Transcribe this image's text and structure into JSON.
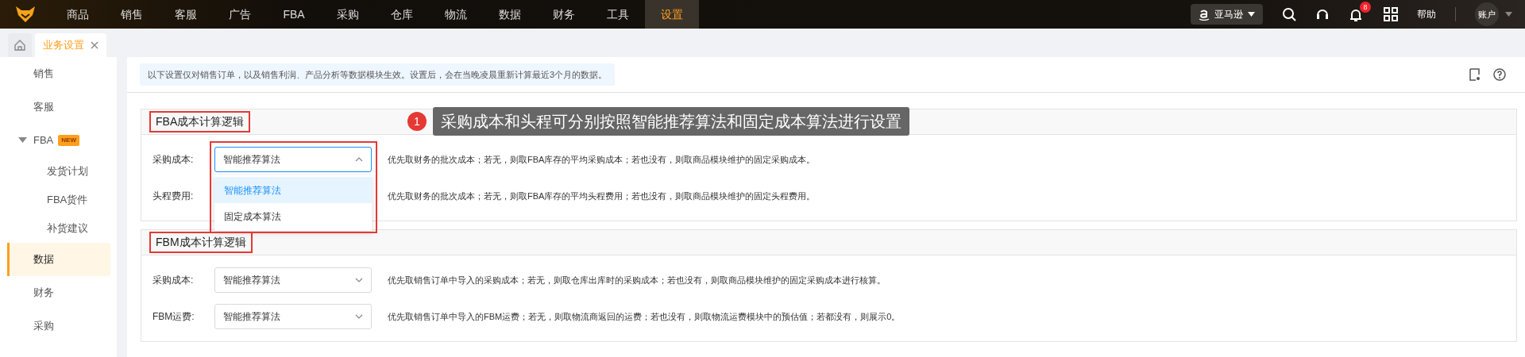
{
  "top_nav": {
    "items": [
      {
        "label": "商品",
        "selected": false
      },
      {
        "label": "销售",
        "selected": false
      },
      {
        "label": "客服",
        "selected": false
      },
      {
        "label": "广告",
        "selected": false
      },
      {
        "label": "FBA",
        "selected": false
      },
      {
        "label": "采购",
        "selected": false
      },
      {
        "label": "仓库",
        "selected": false
      },
      {
        "label": "物流",
        "selected": false
      },
      {
        "label": "数据",
        "selected": false
      },
      {
        "label": "财务",
        "selected": false
      },
      {
        "label": "工具",
        "selected": false
      },
      {
        "label": "设置",
        "selected": true
      }
    ],
    "marketplace": "亚马逊",
    "notification_count": "8",
    "help": "帮助",
    "account": "账户"
  },
  "tabs": [
    {
      "label": "业务设置",
      "selected": true
    }
  ],
  "sidebar": {
    "items": [
      {
        "label": "销售",
        "selected": false
      },
      {
        "label": "客服",
        "selected": false
      },
      {
        "label": "FBA",
        "badge": "NEW",
        "expanded": true,
        "selected": false,
        "children": [
          {
            "label": "发货计划",
            "selected": false
          },
          {
            "label": "FBA货件",
            "selected": false
          },
          {
            "label": "补货建议",
            "selected": false
          }
        ]
      },
      {
        "label": "数据",
        "selected": true
      },
      {
        "label": "财务",
        "selected": false
      },
      {
        "label": "采购",
        "selected": false
      }
    ]
  },
  "notice": "以下设置仅对销售订单，以及销售利润、产品分析等数据模块生效。设置后，会在当晚凌晨重新计算最近3个月的数据。",
  "sections": [
    {
      "title": "FBA成本计算逻辑",
      "highlighted": true,
      "rows": [
        {
          "label": "采购成本:",
          "value": "智能推荐算法",
          "expanded": true,
          "options": [
            {
              "label": "智能推荐算法",
              "selected": true
            },
            {
              "label": "固定成本算法",
              "selected": false
            }
          ],
          "description": "优先取财务的批次成本；若无，则取FBA库存的平均采购成本；若也没有，则取商品模块维护的固定采购成本。"
        },
        {
          "label": "头程费用:",
          "description": "优先取财务的批次成本；若无，则取FBA库存的平均头程费用；若也没有，则取商品模块维护的固定头程费用。"
        }
      ]
    },
    {
      "title": "FBM成本计算逻辑",
      "highlighted": true,
      "rows": [
        {
          "label": "采购成本:",
          "value": "智能推荐算法",
          "expanded": false,
          "description": "优先取销售订单中导入的采购成本；若无，则取仓库出库时的采购成本；若也没有，则取商品模块维护的固定采购成本进行核算。"
        },
        {
          "label": "FBM运费:",
          "value": "智能推荐算法",
          "expanded": false,
          "description": "优先取销售订单中导入的FBM运费；若无，则取物流商返回的运费；若也没有，则取物流运费模块中的预估值；若都没有，则展示0。"
        }
      ]
    }
  ],
  "annotation": {
    "number": "1",
    "text": "采购成本和头程可分别按照智能推荐算法和固定成本算法进行设置"
  }
}
